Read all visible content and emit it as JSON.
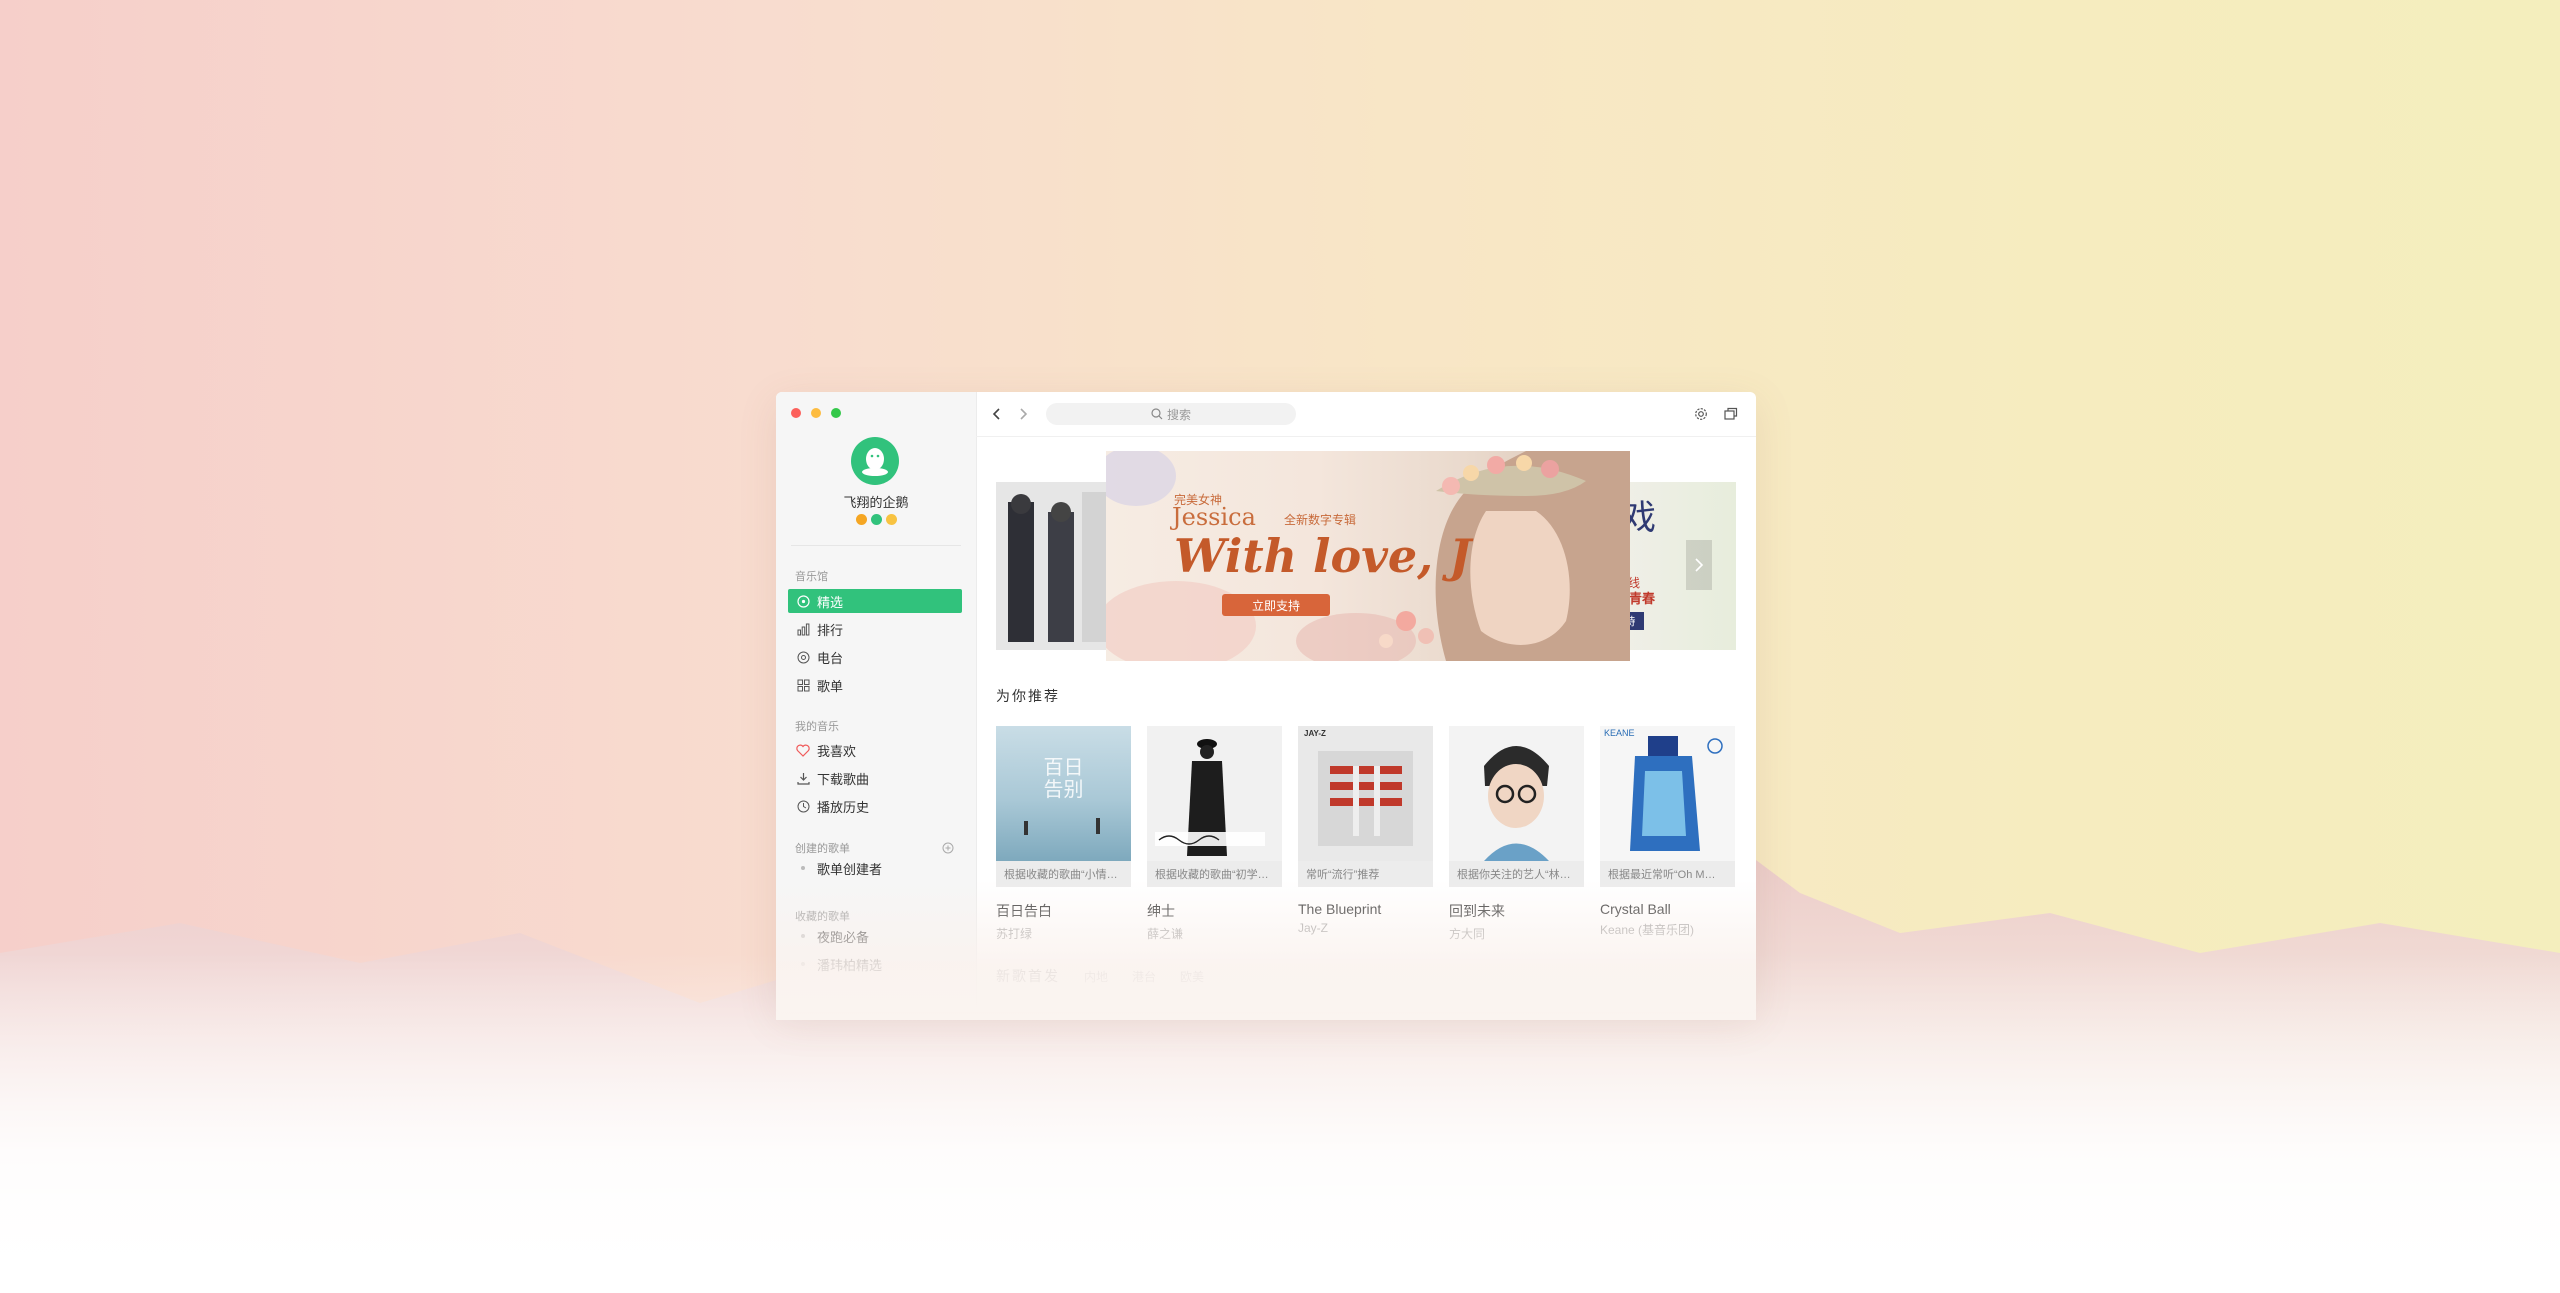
{
  "app": {
    "nickname": "飞翔的企鹅",
    "accent_color": "#31c27c"
  },
  "sidebar": {
    "sections": {
      "music_hall": "音乐馆",
      "my_music": "我的音乐",
      "created_playlists": "创建的歌单",
      "collected_playlists": "收藏的歌单"
    },
    "music_hall_items": [
      {
        "label": "精选",
        "icon": "disc-icon",
        "active": true
      },
      {
        "label": "排行",
        "icon": "chart-icon"
      },
      {
        "label": "电台",
        "icon": "radio-icon"
      },
      {
        "label": "歌单",
        "icon": "grid-icon"
      }
    ],
    "my_music_items": [
      {
        "label": "我喜欢",
        "icon": "heart-icon"
      },
      {
        "label": "下载歌曲",
        "icon": "download-icon"
      },
      {
        "label": "播放历史",
        "icon": "clock-icon"
      }
    ],
    "created_items": [
      {
        "label": "歌单创建者"
      }
    ],
    "collected_items": [
      {
        "label": "夜跑必备"
      },
      {
        "label": "潘玮柏精选"
      }
    ]
  },
  "topbar": {
    "search_placeholder": "搜索"
  },
  "banner": {
    "line1": "完美女神",
    "artist": "Jessica",
    "tag": "全新数字专辑",
    "album": "With love, J",
    "button": "立即支持",
    "side_right_line1": "上线",
    "side_right_line2": "转青春",
    "side_right_btn": "持"
  },
  "recommend": {
    "title": "为你推荐",
    "cards": [
      {
        "caption": "根据收藏的歌曲“小情…",
        "title": "百日告白",
        "artist": "苏打绿",
        "cover_text": "百日告别"
      },
      {
        "caption": "根据收藏的歌曲“初学…",
        "title": "绅士",
        "artist": "薛之谦",
        "cover_text": ""
      },
      {
        "caption": "常听“流行”推荐",
        "title": "The Blueprint",
        "artist": "Jay-Z",
        "cover_text": "JAY-Z"
      },
      {
        "caption": "根据你关注的艺人“林…",
        "title": "回到未来",
        "artist": "方大同",
        "cover_text": ""
      },
      {
        "caption": "根据最近常听“Oh M…",
        "title": "Crystal Ball",
        "artist": "Keane (基音乐团)",
        "cover_text": "KEANE"
      }
    ]
  },
  "new_songs": {
    "title": "新歌首发",
    "tabs": [
      "内地",
      "港台",
      "欧美"
    ]
  }
}
